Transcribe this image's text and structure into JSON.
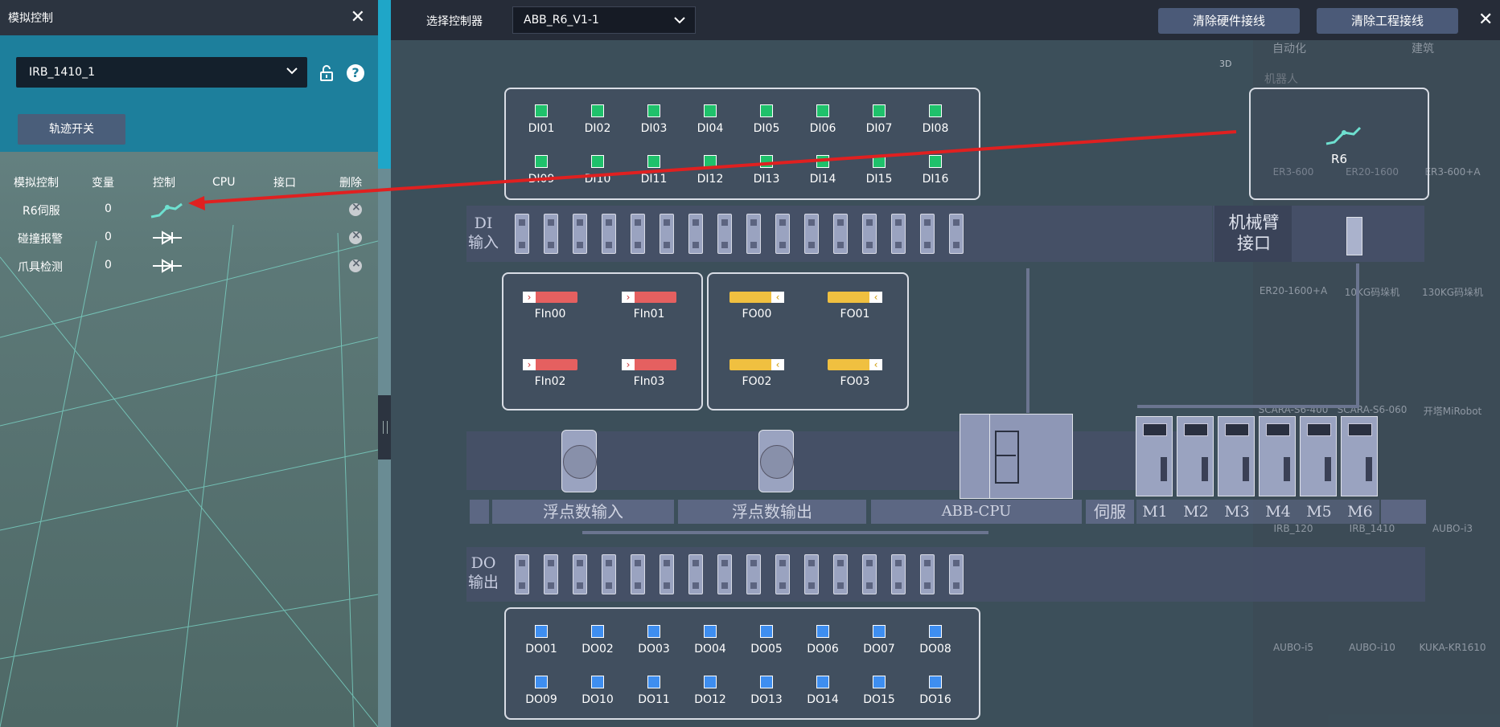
{
  "left_panel": {
    "title": "模拟控制",
    "robot_select": "IRB_1410_1",
    "track_button": "轨迹开关",
    "table_headers": [
      "模拟控制",
      "变量",
      "控制",
      "CPU",
      "接口",
      "删除"
    ],
    "rows": [
      {
        "name": "R6伺服",
        "var": "0",
        "control_icon": "robot-arm-icon"
      },
      {
        "name": "碰撞报警",
        "var": "0",
        "control_icon": "diode-icon"
      },
      {
        "name": "爪具检测",
        "var": "0",
        "control_icon": "diode-icon"
      }
    ]
  },
  "top_bar": {
    "controller_label": "选择控制器",
    "controller_value": "ABB_R6_V1-1",
    "clear_hardware": "清除硬件接线",
    "clear_project": "清除工程接线"
  },
  "di": {
    "labels": [
      "DI01",
      "DI02",
      "DI03",
      "DI04",
      "DI05",
      "DI06",
      "DI07",
      "DI08",
      "DI09",
      "DI10",
      "DI11",
      "DI12",
      "DI13",
      "DI14",
      "DI15",
      "DI16"
    ],
    "rail_label_1": "DI",
    "rail_label_2": "输入"
  },
  "do": {
    "labels": [
      "DO01",
      "DO02",
      "DO03",
      "DO04",
      "DO05",
      "DO06",
      "DO07",
      "DO08",
      "DO09",
      "DO10",
      "DO11",
      "DO12",
      "DO13",
      "DO14",
      "DO15",
      "DO16"
    ],
    "rail_label_1": "DO",
    "rail_label_2": "输出"
  },
  "float_in": [
    "FIn00",
    "FIn01",
    "FIn02",
    "FIn03"
  ],
  "float_out": [
    "FO00",
    "FO01",
    "FO02",
    "FO03"
  ],
  "arm_interface": {
    "line1": "机械臂",
    "line2": "接口"
  },
  "r6_label": "R6",
  "bottom_labels": {
    "float_input": "浮点数输入",
    "float_output": "浮点数输出",
    "cpu": "ABB-CPU",
    "servo": "伺服"
  },
  "motors": [
    "M1",
    "M2",
    "M3",
    "M4",
    "M5",
    "M6"
  ],
  "library": {
    "tabs": [
      "自动化",
      "建筑"
    ],
    "view_3d": "3D",
    "category": "机器人",
    "items": [
      "ER3-600",
      "ER20-1600",
      "ER3-600+A",
      "ER20-1600+A",
      "10KG码垛机",
      "130KG码垛机",
      "SCARA-S6-400",
      "SCARA-S6-060",
      "开塔MiRobot",
      "IRB_120",
      "IRB_1410",
      "AUBO-i3",
      "AUBO-i5",
      "AUBO-i10",
      "KUKA-KR1610"
    ]
  },
  "colors": {
    "di_led": "#1fc16b",
    "do_led": "#3e8ef0",
    "float_in": "#e56060",
    "float_out": "#f0c040",
    "arrow": "#e02020"
  }
}
